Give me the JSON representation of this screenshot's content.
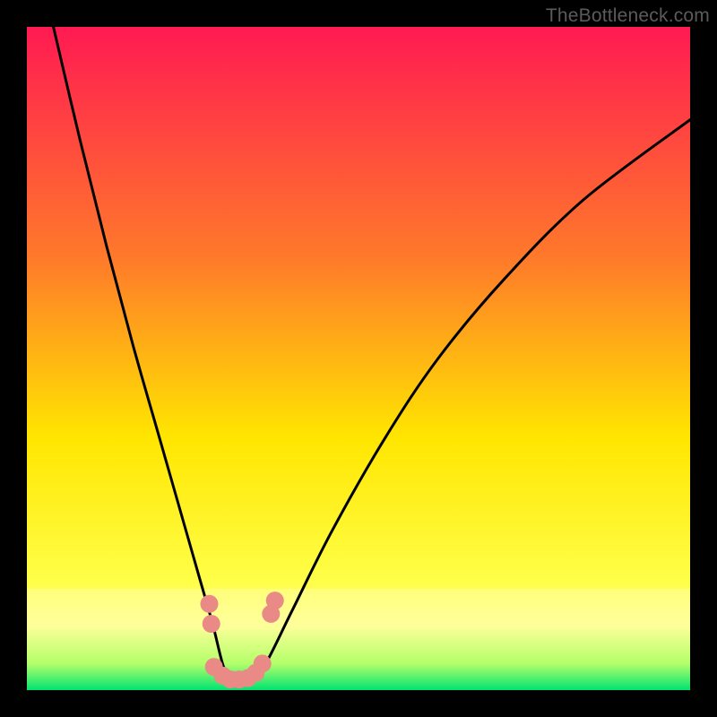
{
  "watermark": "TheBottleneck.com",
  "chart_data": {
    "type": "line",
    "title": "",
    "xlabel": "",
    "ylabel": "",
    "xlim": [
      0,
      100
    ],
    "ylim": [
      0,
      100
    ],
    "grid": false,
    "legend": false,
    "background_gradient": {
      "top": "#ff1a52",
      "mid1": "#ff7a2a",
      "mid2": "#ffe600",
      "band": "#ffff9a",
      "bottom": "#00e472"
    },
    "series": [
      {
        "name": "bottleneck-curve",
        "color": "#000000",
        "x": [
          4,
          8,
          12,
          16,
          20,
          24,
          26,
          28,
          29.5,
          30.5,
          32,
          34,
          36,
          40,
          46,
          54,
          62,
          72,
          84,
          100
        ],
        "y": [
          100,
          83,
          67,
          52,
          38,
          24,
          17,
          10,
          4,
          2,
          1.5,
          2,
          4,
          12,
          24,
          38,
          50,
          62,
          74,
          86
        ]
      }
    ],
    "markers": {
      "name": "sample-points",
      "color": "#e98a86",
      "radius_px": 10,
      "points": [
        {
          "x": 27.5,
          "y": 13
        },
        {
          "x": 27.8,
          "y": 10
        },
        {
          "x": 28.2,
          "y": 3.5
        },
        {
          "x": 29.5,
          "y": 2.2
        },
        {
          "x": 30.7,
          "y": 1.6
        },
        {
          "x": 32.0,
          "y": 1.6
        },
        {
          "x": 33.3,
          "y": 1.8
        },
        {
          "x": 34.5,
          "y": 2.6
        },
        {
          "x": 35.5,
          "y": 4.0
        },
        {
          "x": 36.8,
          "y": 11.5
        },
        {
          "x": 37.4,
          "y": 13.5
        }
      ]
    }
  }
}
